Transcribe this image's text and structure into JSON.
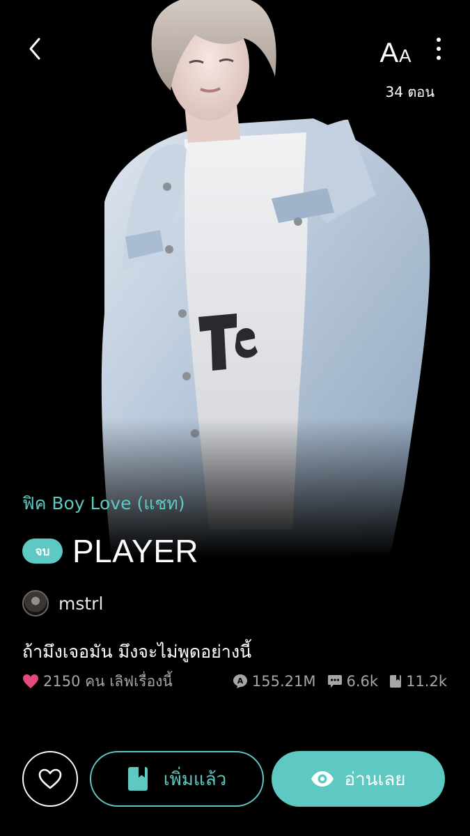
{
  "header": {
    "back_icon": "chevron-left-icon",
    "font_size_label_big": "A",
    "font_size_label_small": "A",
    "more_icon": "more-vertical-icon",
    "episodes": "34 ตอน"
  },
  "story": {
    "category": "ฟิค Boy Love (แชท)",
    "status_badge": "จบ",
    "title": "PLAYER",
    "author": "mstrl",
    "tagline": "ถ้ามึงเจอมัน มึงจะไม่พูดอย่างนี้"
  },
  "stats": {
    "loves_text": "2150 คน เลิฟเรื่องนี้",
    "views": "155.21M",
    "comments": "6.6k",
    "library_adds": "11.2k"
  },
  "actions": {
    "like_icon": "heart-outline-icon",
    "library_label": "เพิ่มแล้ว",
    "read_label": "อ่านเลย"
  },
  "colors": {
    "accent": "#5ec8c2",
    "heart": "#e64a7a",
    "background": "#000000",
    "muted_text": "#a6a6a6"
  }
}
